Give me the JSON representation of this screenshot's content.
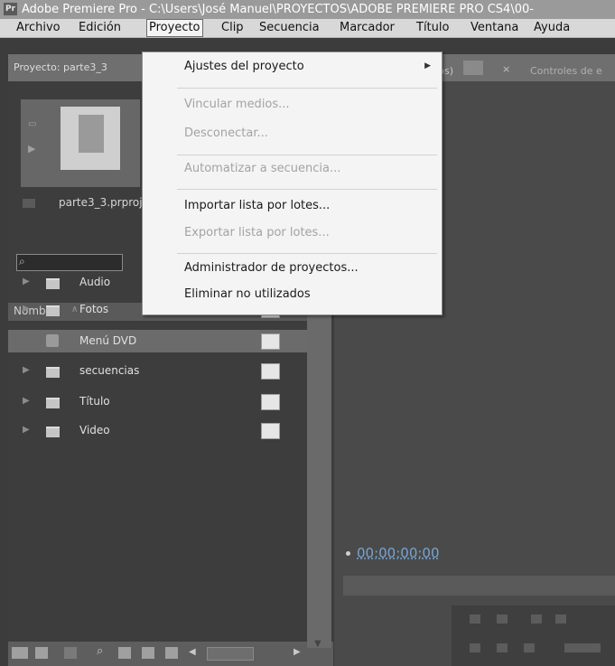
{
  "app": {
    "icon_text": "Pr",
    "title": "Adobe Premiere Pro - C:\\Users\\José Manuel\\PROYECTOS\\ADOBE PREMIERE PRO CS4\\00-"
  },
  "menubar": [
    {
      "label": "Archivo"
    },
    {
      "label": "Edición"
    },
    {
      "label": "Proyecto"
    },
    {
      "label": "Clip"
    },
    {
      "label": "Secuencia"
    },
    {
      "label": "Marcador"
    },
    {
      "label": "Título"
    },
    {
      "label": "Ventana"
    },
    {
      "label": "Ayuda"
    }
  ],
  "project_panel": {
    "tab_label": "Proyecto: parte3_3",
    "file_label": "parte3_3.prproj",
    "column_header": "Nombre",
    "items": [
      {
        "label": "Audio",
        "icon": "folder-icon"
      },
      {
        "label": "Fotos",
        "icon": "folder-icon"
      },
      {
        "label": "Menú DVD",
        "icon": "dvd-icon"
      },
      {
        "label": "secuencias",
        "icon": "folder-icon"
      },
      {
        "label": "Título",
        "icon": "folder-icon"
      },
      {
        "label": "Video",
        "icon": "folder-icon"
      }
    ]
  },
  "monitor": {
    "tab_label": "ips)",
    "controls_tab": "Controles de e",
    "timecode": "00;00;00;00"
  },
  "dropdown": {
    "items": [
      {
        "label": "Ajustes del proyecto",
        "disabled": false,
        "submenu": true
      },
      {
        "label": "Vincular medios...",
        "disabled": true
      },
      {
        "label": "Desconectar...",
        "disabled": true
      },
      {
        "label": "Automatizar a secuencia...",
        "disabled": true
      },
      {
        "label": "Importar lista por lotes...",
        "disabled": false
      },
      {
        "label": "Exportar lista por lotes...",
        "disabled": true
      },
      {
        "label": "Administrador de proyectos...",
        "disabled": false
      },
      {
        "label": "Eliminar no utilizados",
        "disabled": false
      }
    ]
  },
  "colors": {
    "timecode": "#76a5d2"
  }
}
